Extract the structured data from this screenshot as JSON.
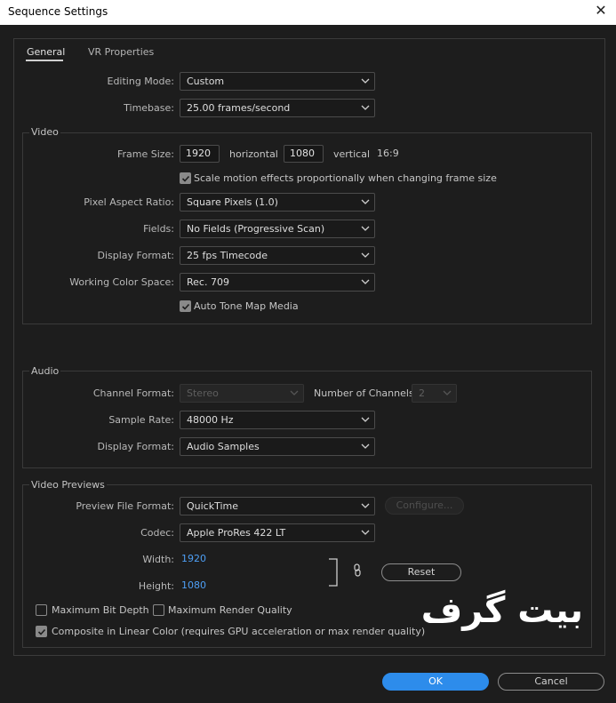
{
  "window": {
    "title": "Sequence Settings",
    "close_icon": "close-icon"
  },
  "tabs": [
    {
      "label": "General",
      "active": true
    },
    {
      "label": "VR Properties",
      "active": false
    }
  ],
  "general": {
    "editing_mode_label": "Editing Mode:",
    "editing_mode_value": "Custom",
    "timebase_label": "Timebase:",
    "timebase_value": "25.00  frames/second"
  },
  "video": {
    "title": "Video",
    "frame_size_label": "Frame Size:",
    "frame_width": "1920",
    "horizontal_label": "horizontal",
    "frame_height": "1080",
    "vertical_label": "vertical",
    "aspect_ratio": "16:9",
    "scale_motion_label": "Scale motion effects proportionally when changing frame size",
    "scale_motion_checked": true,
    "pixel_aspect_label": "Pixel Aspect Ratio:",
    "pixel_aspect_value": "Square Pixels (1.0)",
    "fields_label": "Fields:",
    "fields_value": "No Fields (Progressive Scan)",
    "display_format_label": "Display Format:",
    "display_format_value": "25 fps Timecode",
    "working_color_label": "Working Color Space:",
    "working_color_value": "Rec. 709",
    "auto_tone_label": "Auto Tone Map Media",
    "auto_tone_checked": true
  },
  "audio": {
    "title": "Audio",
    "channel_format_label": "Channel Format:",
    "channel_format_value": "Stereo",
    "num_channels_label": "Number of Channels:",
    "num_channels_value": "2",
    "sample_rate_label": "Sample Rate:",
    "sample_rate_value": "48000 Hz",
    "display_format_label": "Display Format:",
    "display_format_value": "Audio Samples"
  },
  "previews": {
    "title": "Video Previews",
    "file_format_label": "Preview File Format:",
    "file_format_value": "QuickTime",
    "configure_label": "Configure...",
    "codec_label": "Codec:",
    "codec_value": "Apple ProRes 422 LT",
    "width_label": "Width:",
    "width_value": "1920",
    "height_label": "Height:",
    "height_value": "1080",
    "reset_label": "Reset",
    "max_bit_depth_label": "Maximum Bit Depth",
    "max_bit_depth_checked": false,
    "max_render_label": "Maximum Render Quality",
    "max_render_checked": false,
    "linear_color_label": "Composite in Linear Color (requires GPU acceleration or max render quality)",
    "linear_color_checked": true
  },
  "watermark": "بیت گرف",
  "footer": {
    "ok_label": "OK",
    "cancel_label": "Cancel"
  },
  "colors": {
    "accent": "#2d8ceb",
    "link_blue": "#4e9ff5",
    "background": "#1d1d1d"
  }
}
